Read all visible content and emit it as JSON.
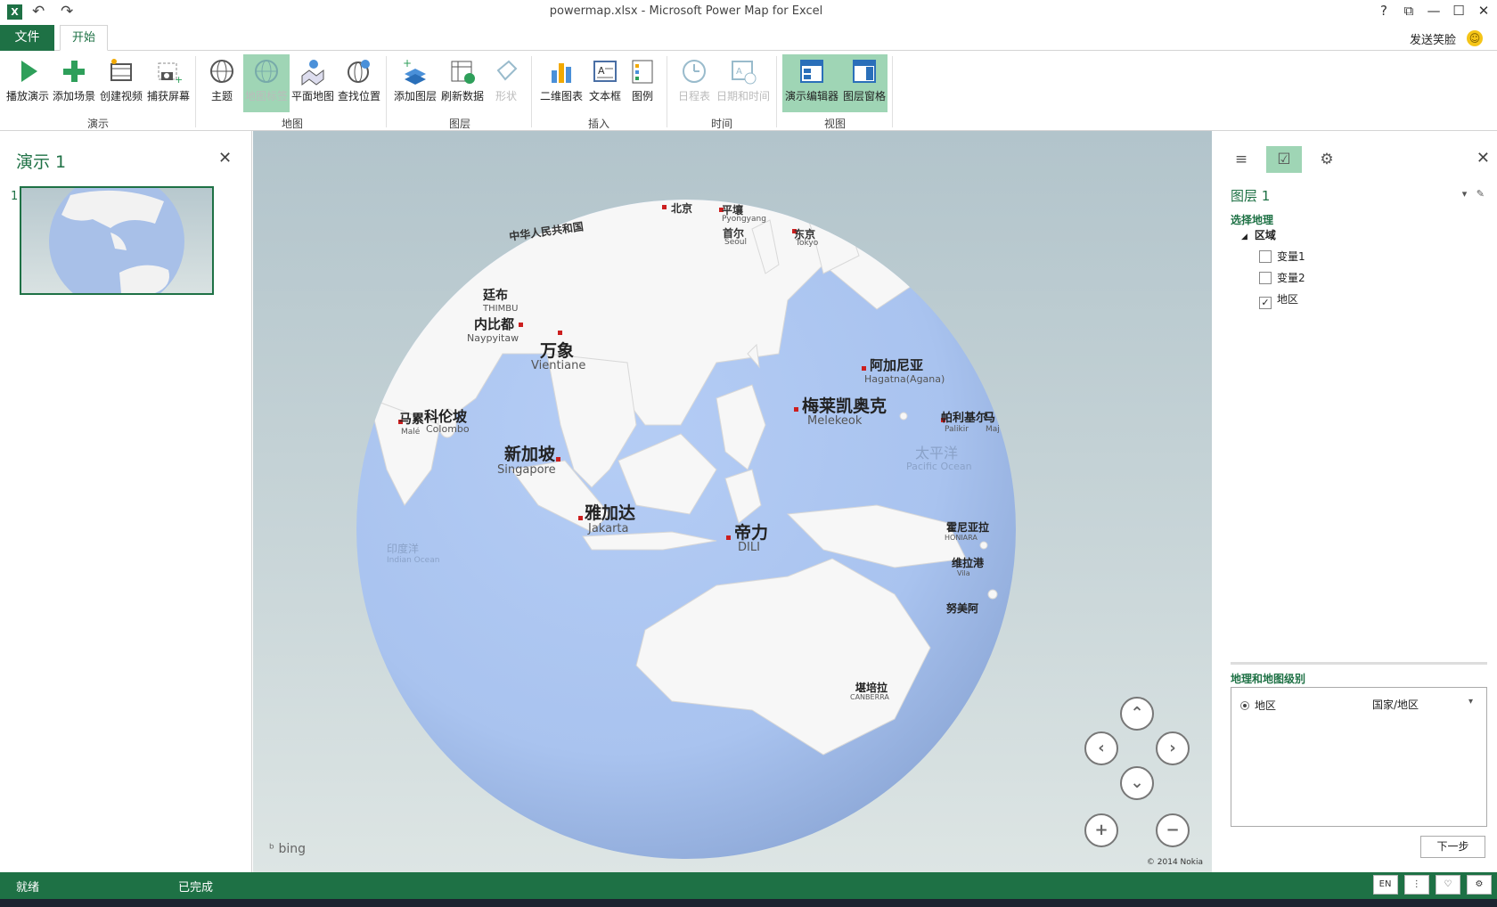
{
  "window": {
    "title": "powermap.xlsx - Microsoft Power Map for Excel",
    "help": "?",
    "controls": [
      "⧉",
      "—",
      "☐",
      "✕"
    ]
  },
  "tabs": {
    "file": "文件",
    "home": "开始"
  },
  "feedback": "发送笑脸",
  "ribbon": {
    "tour_group": "演示",
    "map_group": "地图",
    "layer_group": "图层",
    "insert_group": "插入",
    "time_group": "时间",
    "view_group": "视图",
    "buttons": {
      "play": "播放演示",
      "add_scene": "添加场景",
      "create_video": "创建视频",
      "capture": "捕获屏幕",
      "theme": "主题",
      "map_labels": "地图标签",
      "flat_map": "平面地图",
      "find_location": "查找位置",
      "add_layer": "添加图层",
      "refresh": "刷新数据",
      "shape": "形状",
      "chart2d": "二维图表",
      "textbox": "文本框",
      "legend": "图例",
      "timeline": "日程表",
      "datetime": "日期和时间",
      "tour_editor": "演示编辑器",
      "layer_pane": "图层窗格"
    }
  },
  "left_panel": {
    "title": "演示 1",
    "scene_number": "1"
  },
  "map": {
    "attribution": "bing",
    "copyright": "© 2014 Nokia",
    "labels": [
      {
        "cn": "中华人民共和国",
        "en": ""
      },
      {
        "cn": "北京",
        "en": ""
      },
      {
        "cn": "平壤",
        "en": "Pyongyang"
      },
      {
        "cn": "首尔",
        "en": "Seoul"
      },
      {
        "cn": "东京",
        "en": "Tokyo"
      },
      {
        "cn": "廷布",
        "en": "THIMBU"
      },
      {
        "cn": "内比都",
        "en": "Naypyitaw"
      },
      {
        "cn": "万象",
        "en": "Vientiane"
      },
      {
        "cn": "马累",
        "en": "Malé"
      },
      {
        "cn": "科伦坡",
        "en": "Colombo"
      },
      {
        "cn": "新加坡",
        "en": "Singapore"
      },
      {
        "cn": "雅加达",
        "en": "Jakarta"
      },
      {
        "cn": "帝力",
        "en": "DILI"
      },
      {
        "cn": "阿加尼亚",
        "en": "Hagatna(Agana)"
      },
      {
        "cn": "梅莱凯奥克",
        "en": "Melekeok"
      },
      {
        "cn": "帕利基尔",
        "en": "Palikir"
      },
      {
        "cn": "马",
        "en": "Maj"
      },
      {
        "cn": "太平洋",
        "en": "Pacific Ocean"
      },
      {
        "cn": "霍尼亚拉",
        "en": "HONIARA"
      },
      {
        "cn": "维拉港",
        "en": "Vila"
      },
      {
        "cn": "努美阿",
        "en": ""
      },
      {
        "cn": "堪培拉",
        "en": "CANBERRA"
      },
      {
        "cn": "印度洋",
        "en": "Indian Ocean"
      }
    ]
  },
  "right_panel": {
    "layer_title": "图层 1",
    "select_geo": "选择地理",
    "region": "区域",
    "fields": [
      {
        "label": "变量1",
        "checked": false
      },
      {
        "label": "变量2",
        "checked": false
      },
      {
        "label": "地区",
        "checked": true
      }
    ],
    "geo_level_title": "地理和地图级别",
    "geo_field": "地区",
    "geo_level": "国家/地区",
    "next": "下一步"
  },
  "status": {
    "left": "就绪",
    "right": "已完成",
    "lang": "EN"
  }
}
